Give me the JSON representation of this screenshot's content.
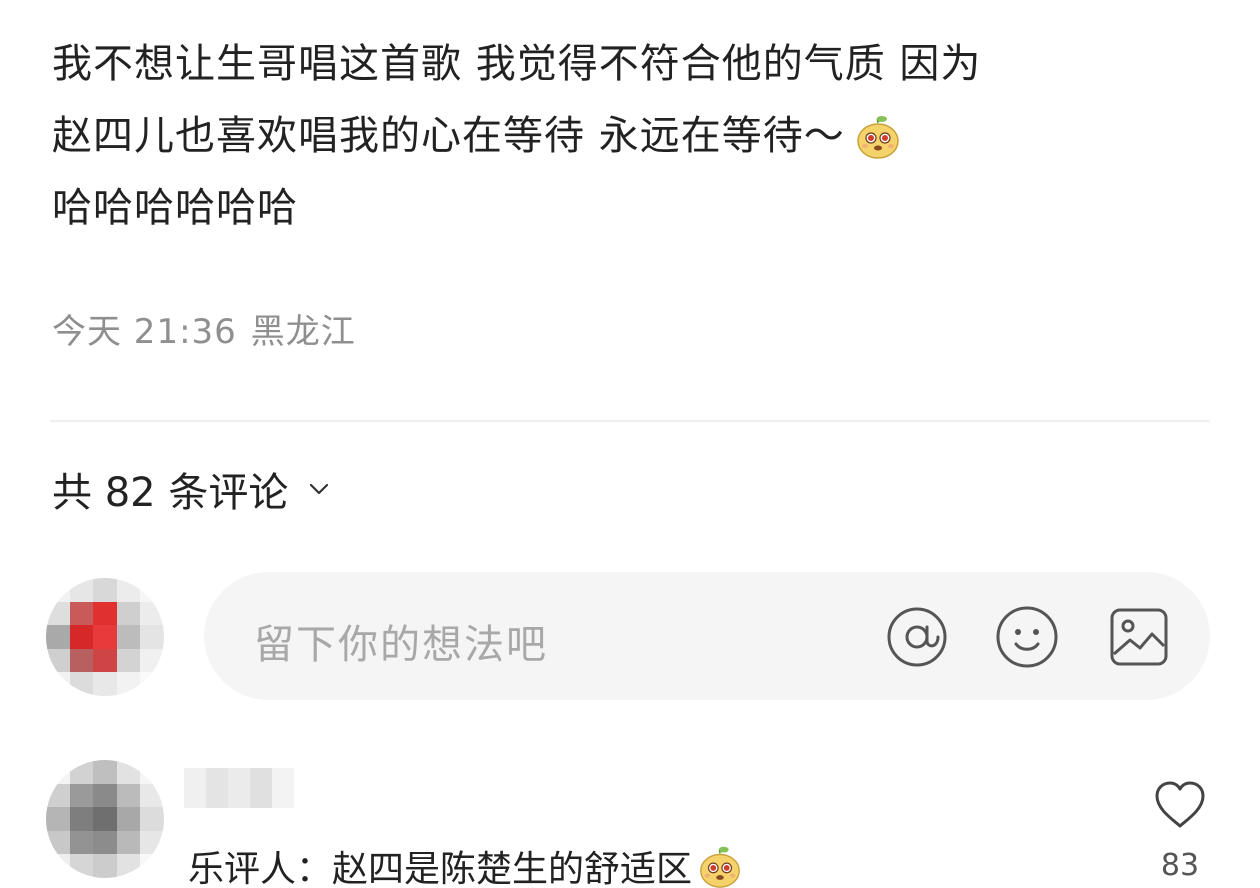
{
  "post": {
    "lines": [
      "我不想让生哥唱这首歌 我觉得不符合他的气质 因为",
      "赵四儿也喜欢唱我的心在等待 永远在等待～",
      "哈哈哈哈哈哈"
    ],
    "emoji_icon": "cute-mascot-emoji-icon"
  },
  "meta": {
    "time": "今天 21:36",
    "location": "黑龙江"
  },
  "comments_header": {
    "label": "共 82 条评论",
    "chevron_icon": "chevron-down-icon"
  },
  "composer": {
    "placeholder": "留下你的想法吧",
    "icons": [
      "at-icon",
      "smile-icon",
      "image-icon"
    ]
  },
  "comments": [
    {
      "text": "乐评人：赵四是陈楚生的舒适区",
      "likes": "83",
      "like_icon": "heart-icon"
    }
  ],
  "colors": {
    "text": "#222222",
    "meta": "#8f8f8f",
    "placeholder": "#a8a8a8",
    "input_bg": "#f5f5f5"
  }
}
